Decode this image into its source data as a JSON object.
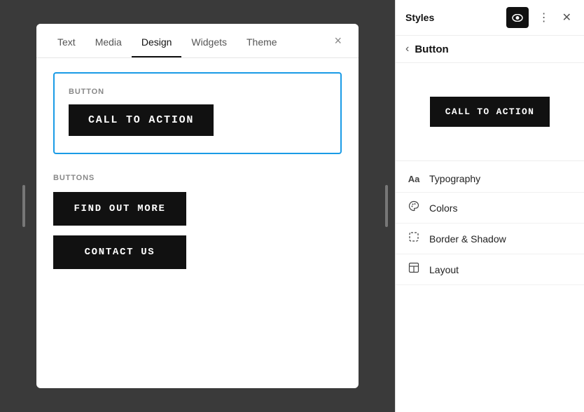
{
  "app": {
    "title": "Styles"
  },
  "tabs": {
    "items": [
      {
        "label": "Text",
        "active": false
      },
      {
        "label": "Media",
        "active": false
      },
      {
        "label": "Design",
        "active": true
      },
      {
        "label": "Widgets",
        "active": false
      },
      {
        "label": "Theme",
        "active": false
      }
    ],
    "close_label": "×"
  },
  "editor": {
    "button_section_label": "BUTTON",
    "button_cta_label": "CALL TO ACTION",
    "buttons_section_label": "BUTTONS",
    "buttons": [
      {
        "label": "FIND OUT MORE"
      },
      {
        "label": "CONTACT US"
      }
    ]
  },
  "styles_panel": {
    "title": "Styles",
    "back_label": "Button",
    "preview_cta": "CALL TO ACTION",
    "options": [
      {
        "key": "typography",
        "label": "Typography",
        "icon": "Aa"
      },
      {
        "key": "colors",
        "label": "Colors",
        "icon": "◯"
      },
      {
        "key": "border_shadow",
        "label": "Border & Shadow",
        "icon": "⊡"
      },
      {
        "key": "layout",
        "label": "Layout",
        "icon": "⊞"
      }
    ]
  }
}
